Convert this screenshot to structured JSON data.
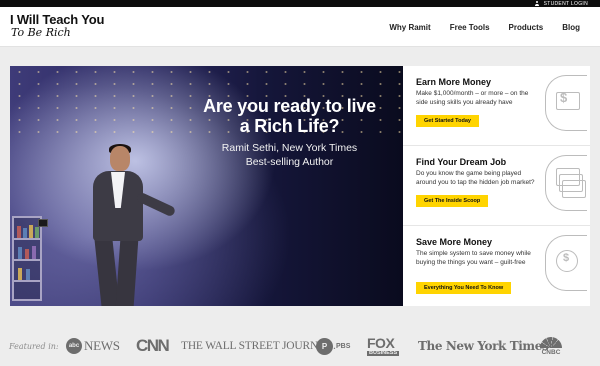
{
  "topbar": {
    "student_login": "STUDENT LOGIN",
    "icon": "user-icon"
  },
  "header": {
    "logo_line1": "I Will Teach You",
    "logo_line2": "To Be Rich",
    "nav": [
      "Why Ramit",
      "Free Tools",
      "Products",
      "Blog"
    ]
  },
  "hero": {
    "headline": "Are you ready to live a Rich Life?",
    "subline1": "Ramit Sethi, New York Times",
    "subline2": "Best-selling Author"
  },
  "cards": [
    {
      "title": "Earn More Money",
      "text": "Make $1,000/month – or more – on the side using skills you already have",
      "button": "Get Started Today",
      "icon": "money-bill-icon"
    },
    {
      "title": "Find Your Dream Job",
      "text": "Do you know the game being played around you to tap the hidden job market?",
      "button": "Get The Inside Scoop",
      "icon": "stacked-bills-icon"
    },
    {
      "title": "Save More Money",
      "text": "The simple system to save money while buying the things you want – guilt-free",
      "button": "Everything You Need To Know",
      "icon": "magnifier-dollar-icon"
    }
  ],
  "featured": {
    "label": "Featured in:",
    "logos": {
      "abc_ball": "abc",
      "abc_text": "NEWS",
      "cnn": "CNN",
      "wsj": "THE WALL STREET JOURNAL.",
      "pbs_icon": "P",
      "pbs": "PBS",
      "fox_top": "FOX",
      "fox_bottom": "BUSINESS",
      "nyt": "The New York Times",
      "cnbc": "CNBC"
    }
  },
  "colors": {
    "accent_yellow": "#ffd400",
    "topbar": "#0d0d0d",
    "page_bg": "#ededed"
  }
}
